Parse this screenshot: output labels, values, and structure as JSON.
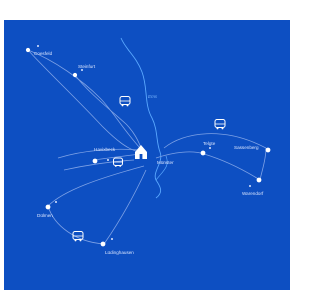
{
  "colors": {
    "background": "#0d4fc2",
    "route": "#7ea2e6",
    "river": "#5aa8ff",
    "node": "#ffffff",
    "label": "#dbe6ff"
  },
  "map": {
    "center_label": "Münster",
    "river_label": "Ems",
    "places": [
      {
        "name": "Coesfeld"
      },
      {
        "name": "Steinfurt"
      },
      {
        "name": "Havixbeck"
      },
      {
        "name": "Telgte"
      },
      {
        "name": "Sassenberg"
      },
      {
        "name": "Warendorf"
      },
      {
        "name": "Dülmen"
      },
      {
        "name": "Lüdinghausen"
      }
    ],
    "icons": {
      "center": "house-icon",
      "transit": "bus-icon",
      "place": "location-dot-icon"
    }
  }
}
